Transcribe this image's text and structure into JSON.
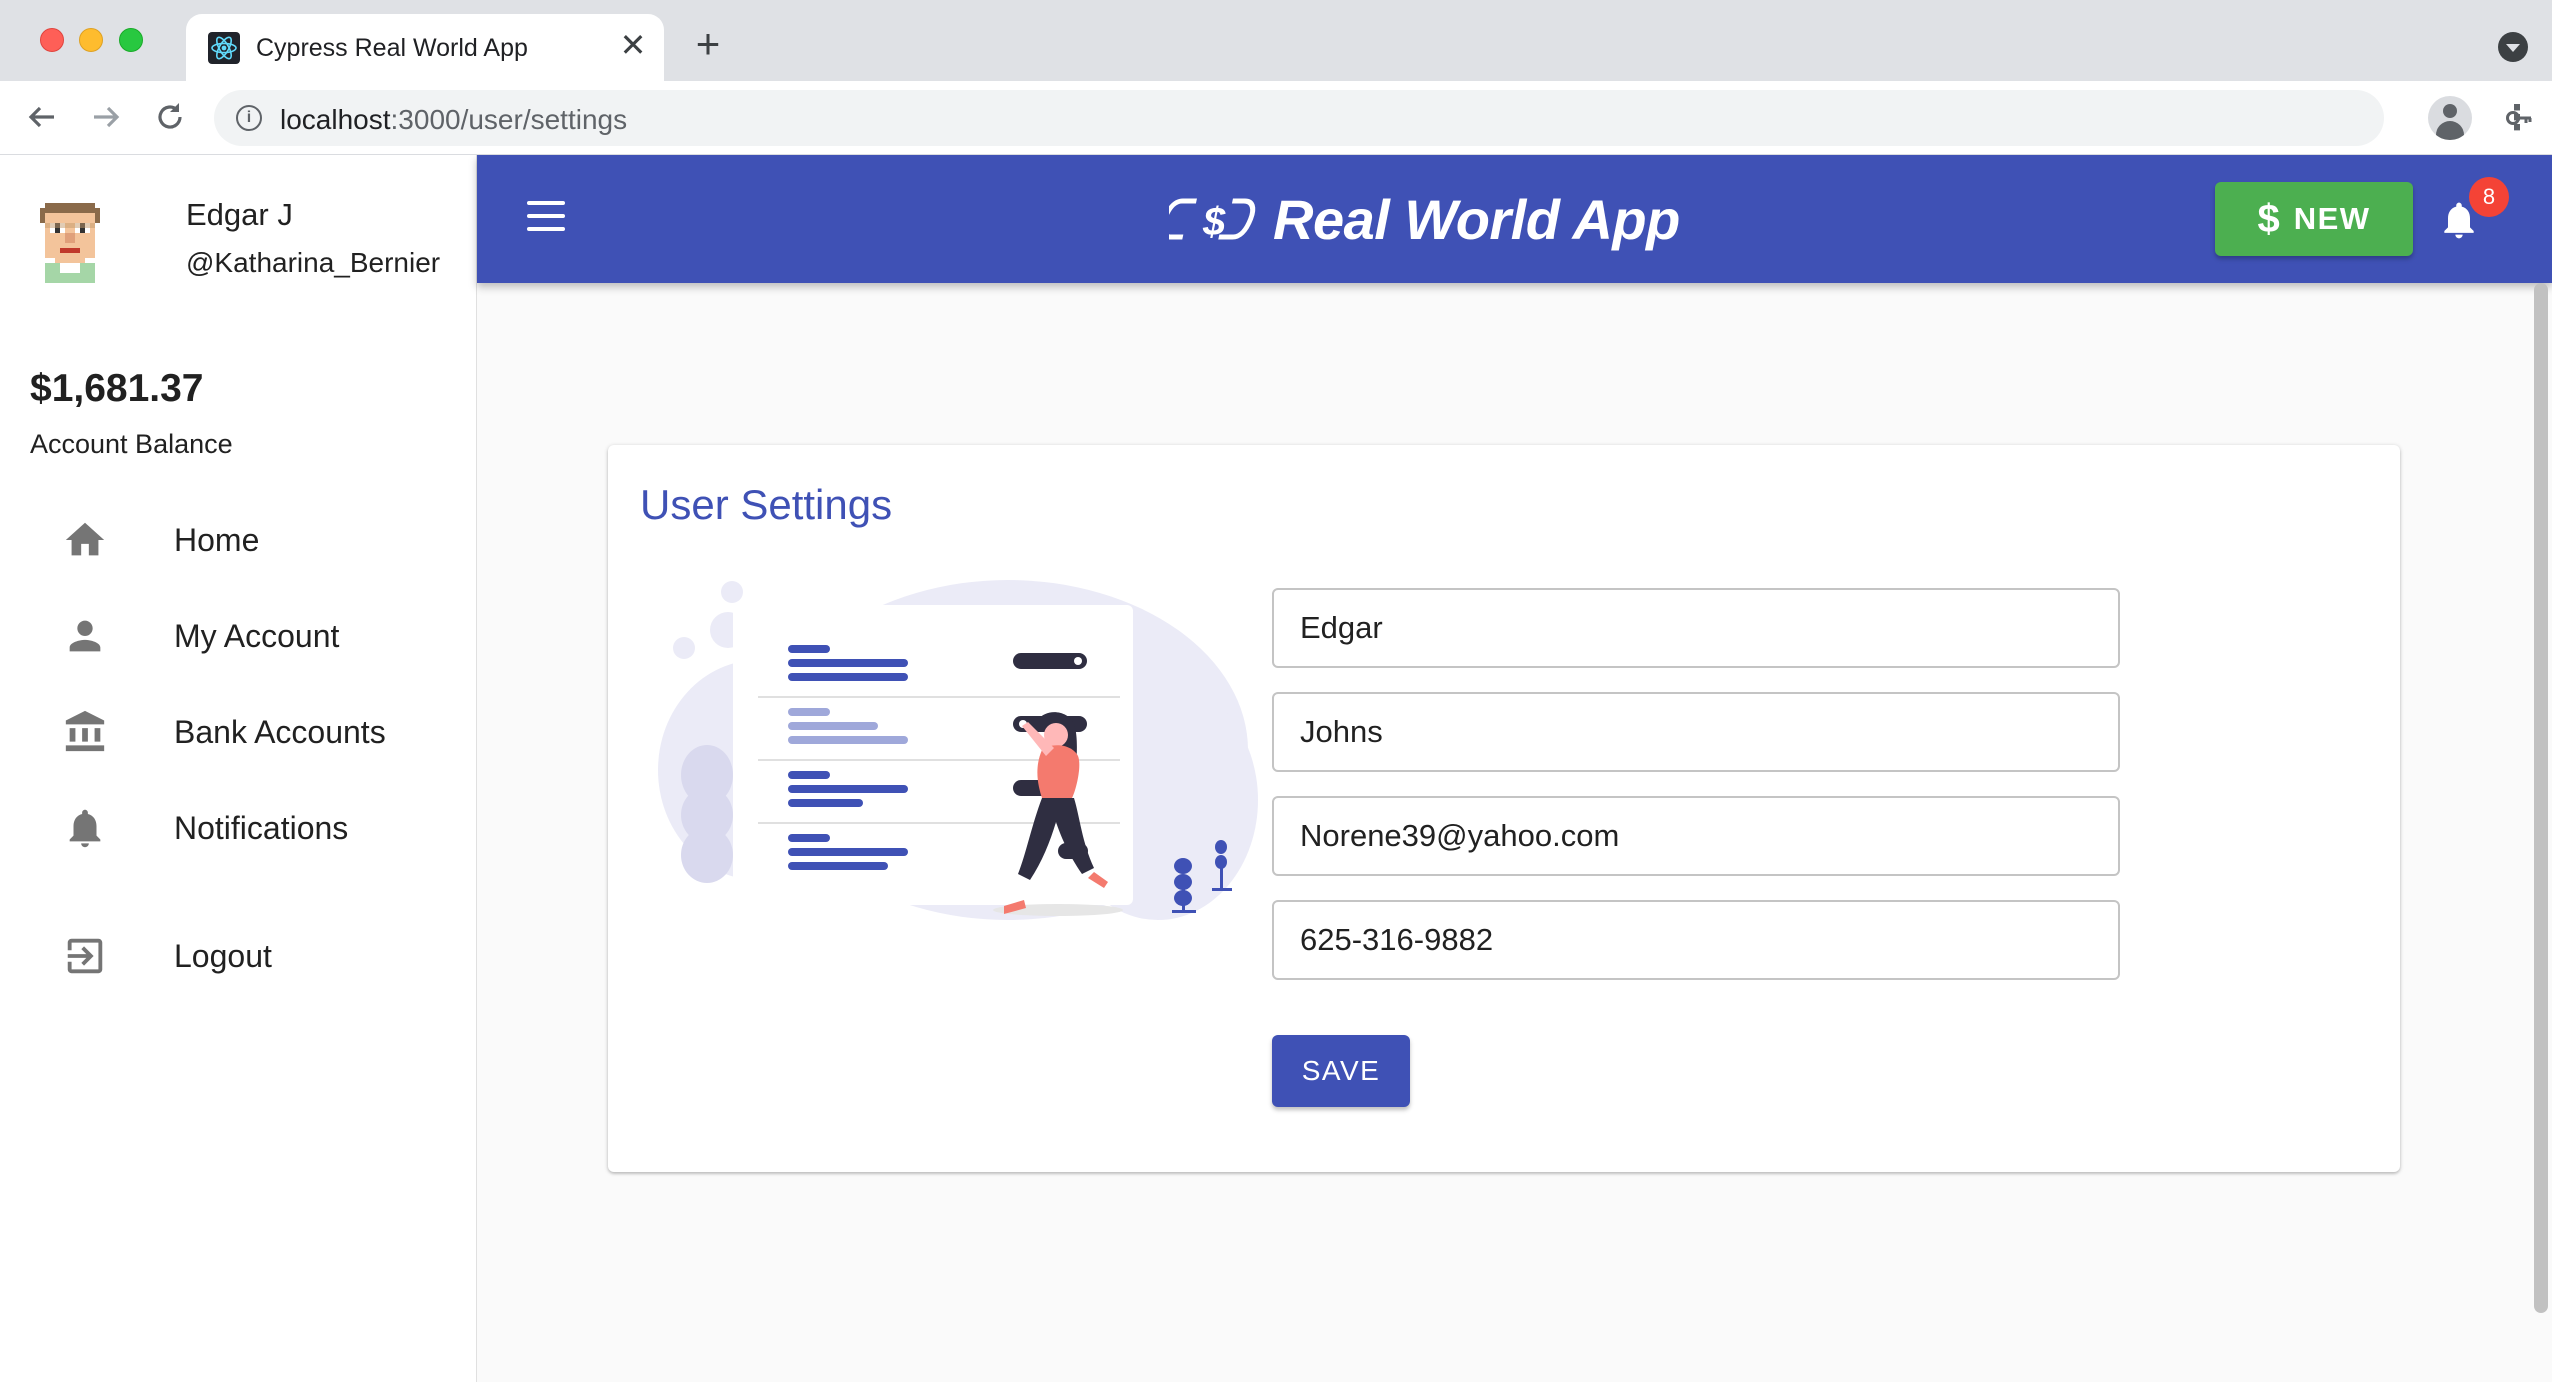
{
  "browser": {
    "tab_title": "Cypress Real World App",
    "tab_close": "✕",
    "new_tab": "+",
    "url_host": "localhost",
    "url_path": ":3000/user/settings"
  },
  "user": {
    "name": "Edgar J",
    "handle": "@Katharina_Bernier",
    "balance": "$1,681.37",
    "balance_label": "Account Balance"
  },
  "nav": {
    "items": [
      {
        "label": "Home",
        "icon": "home-icon"
      },
      {
        "label": "My Account",
        "icon": "person-icon"
      },
      {
        "label": "Bank Accounts",
        "icon": "bank-icon"
      },
      {
        "label": "Notifications",
        "icon": "bell-icon"
      },
      {
        "label": "Logout",
        "icon": "logout-icon"
      }
    ]
  },
  "appbar": {
    "brand": "Real World App",
    "new_symbol": "$",
    "new_label": "NEW",
    "notification_count": "8"
  },
  "settings": {
    "title": "User Settings",
    "first_name": "Edgar",
    "last_name": "Johns",
    "email": "Norene39@yahoo.com",
    "phone": "625-316-9882",
    "save_label": "SAVE"
  },
  "colors": {
    "primary": "#3f51b5",
    "success": "#4caf50",
    "badge": "#f44336"
  }
}
